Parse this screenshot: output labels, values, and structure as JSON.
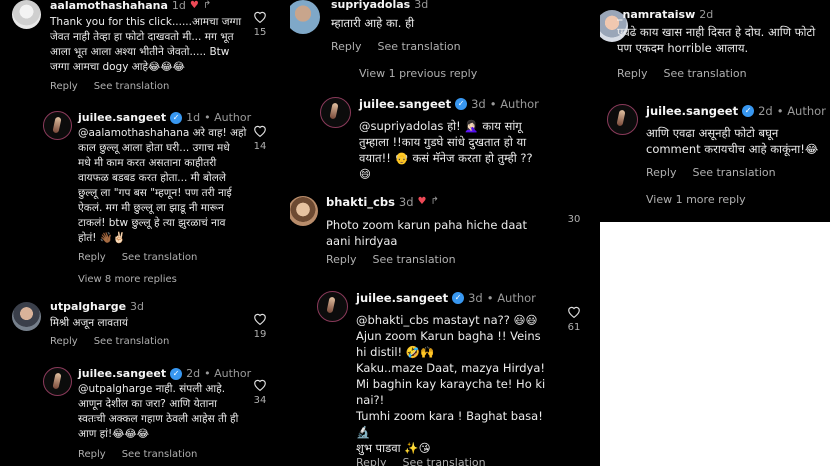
{
  "panel1": {
    "c1": {
      "user": "aalamothashahana",
      "time": "1d",
      "lines": [
        "Thank you for this click......आमचा जग्गा",
        "जेवत नाही तेव्हा हा फोटो दाखवतो मी... मग भूत",
        "आला भूत आला अश्या भीतीने जेवतो..... Btw",
        "जग्गा आमचा dogy आहे😂😂😂"
      ],
      "reply": "Reply",
      "see": "See translation",
      "likes": "15"
    },
    "c2": {
      "user": "juilee.sangeet",
      "time": "1d",
      "author": "Author",
      "lines": [
        "@aalamothashahana अरे वाह! अहो",
        "काल छुल्लू आला होता घरी... उगाच मधे",
        "मधे मी काम करत असताना काहीतरी",
        "वायफळ बडबड करत होता... मी बोलले",
        "छुल्लू ला \"गप बस \"म्हणून! पण तरी नाई",
        "ऐकलं. मग मी छुल्लू ला झाडू नी मारून",
        "टाकलं! btw छुल्लू हे त्या झुरळाचं नाव",
        "होतं! 👋🏾✌🏻"
      ],
      "reply": "Reply",
      "see": "See translation",
      "likes": "14"
    },
    "view_more": "View 8 more replies",
    "c3": {
      "user": "utpalgharge",
      "time": "3d",
      "lines": [
        "मिश्री अजून लावतायं"
      ],
      "reply": "Reply",
      "see": "See translation",
      "likes": "19"
    },
    "c4": {
      "user": "juilee.sangeet",
      "time": "2d",
      "author": "Author",
      "lines": [
        "@utpalgharge नाही. संपली आहे.",
        "आणून देशील का जरा? आणि येताना",
        "स्वतःची अक्कल गहाण ठेवली आहेस ती ही",
        "आण हां!😂😂😂"
      ],
      "reply": "Reply",
      "see": "See translation",
      "likes": "34"
    }
  },
  "panel2": {
    "c1": {
      "user": "supriyadolas",
      "time": "3d",
      "lines": [
        "म्हातारी आहे का. ही"
      ],
      "reply": "Reply",
      "see": "See translation"
    },
    "view_prev": "View 1 previous reply",
    "c2": {
      "user": "juilee.sangeet",
      "time": "3d",
      "author": "Author",
      "lines": [
        "@supriyadolas हो! 🤦🏻‍♀️ काय सांगू",
        "तुम्हाला !!काय गुडघे सांधे दुखतात हो या",
        "वयात!! 👴 कसं मॅनेज करता हो तुम्ही ??",
        "😄"
      ]
    },
    "c3": {
      "user": "bhakti_cbs",
      "time": "3d",
      "lines": [
        "Photo zoom karun paha hiche daat",
        "aani hirdyaa"
      ],
      "reply": "Reply",
      "see": "See translation",
      "likes": "30"
    },
    "c4": {
      "user": "juilee.sangeet",
      "time": "3d",
      "author": "Author",
      "lines": [
        "@bhakti_cbs mastayt na?? 😃😃",
        "Ajun zoom Karun bagha !! Veins",
        "hi distil! 🤣🙌",
        "Kaku..maze Daat, mazya Hirdya!",
        "Mi baghin kay karaycha te! Ho ki",
        "nai?!",
        "Tumhi zoom kara ! Baghat basa!",
        "🔬",
        "शुभ पाडवा ✨😘"
      ],
      "reply": "Reply",
      "see": "See translation",
      "likes": "61"
    }
  },
  "panel3": {
    "c1": {
      "user": "_namrataisw",
      "time": "2d",
      "lines": [
        "एवढे काय खास नाही दिसत हे दोघ. आणि फोटो",
        "पण एकदम horrible आलाय."
      ],
      "reply": "Reply",
      "see": "See translation"
    },
    "c2": {
      "user": "juilee.sangeet",
      "time": "2d",
      "author": "Author",
      "lines": [
        "आणि एवढा असूनही फोटो बघून",
        "comment करायचीच आहे काकूंना!😂"
      ],
      "reply": "Reply",
      "see": "See translation"
    },
    "view_more": "View 1 more reply"
  },
  "icons": {
    "heart": "heart-icon",
    "verified": "verified-badge-icon",
    "reply_arrow": "reply-arrow-icon"
  },
  "colors": {
    "background": "#000000",
    "verified": "#3897f0",
    "liked": "#ed4956"
  }
}
